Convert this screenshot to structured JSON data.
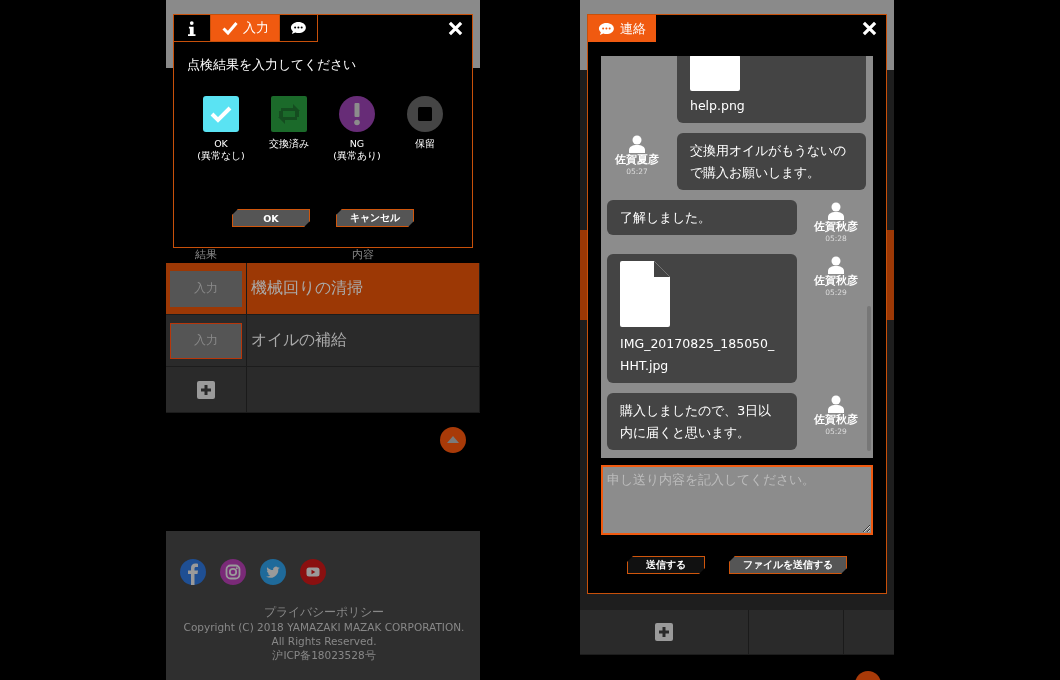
{
  "left_screen": {
    "table": {
      "columns": [
        "結果",
        "内容"
      ],
      "rows": [
        {
          "button": "入力",
          "content": "機械回りの清掃",
          "selected": true
        },
        {
          "button": "入力",
          "content": "オイルの補給",
          "selected": false
        }
      ]
    },
    "footer": {
      "privacy_link": "プライバシーポリシー",
      "copyright": "Copyright (C) 2018 YAMAZAKI MAZAK CORPORATION. All Rights Reserved.",
      "icp": "沪ICP备18023528号"
    },
    "dialog": {
      "tabs": [
        {
          "kind": "info",
          "selected": false
        },
        {
          "kind": "input",
          "label": "入力",
          "selected": true
        },
        {
          "kind": "chat",
          "selected": false
        }
      ],
      "prompt": "点検結果を入力してください",
      "options": [
        {
          "kind": "ok",
          "label_lines": [
            "OK",
            "(異常なし)"
          ]
        },
        {
          "kind": "exchanged",
          "label_lines": [
            "交換済み"
          ]
        },
        {
          "kind": "ng",
          "label_lines": [
            "NG",
            "(異常あり)"
          ]
        },
        {
          "kind": "hold",
          "label_lines": [
            "保留"
          ]
        }
      ],
      "buttons": [
        "OK",
        "キャンセル"
      ]
    }
  },
  "right_screen": {
    "dialog": {
      "title": "連絡",
      "messages": [
        {
          "kind": "file",
          "outgoing": false,
          "file_name": "help.png"
        },
        {
          "kind": "text",
          "outgoing": false,
          "text": "交換用オイルがもうないので購入お願いします。",
          "sender": "佐賀夏彦",
          "time": "05:27"
        },
        {
          "kind": "text",
          "outgoing": true,
          "text": "了解しました。",
          "sender": "佐賀秋彦",
          "time": "05:28"
        },
        {
          "kind": "file",
          "outgoing": true,
          "file_name": "IMG_20170825_185050_HHT.jpg",
          "sender": "佐賀秋彦",
          "time": "05:29"
        },
        {
          "kind": "text",
          "outgoing": true,
          "text": "購入しましたので、3日以内に届くと思います。",
          "sender": "佐賀秋彦",
          "time": "05:29"
        }
      ],
      "message_field": {
        "placeholder": "申し送り内容を記入してください。"
      },
      "buttons": [
        "送信する",
        "ファイルを送信する"
      ]
    }
  }
}
